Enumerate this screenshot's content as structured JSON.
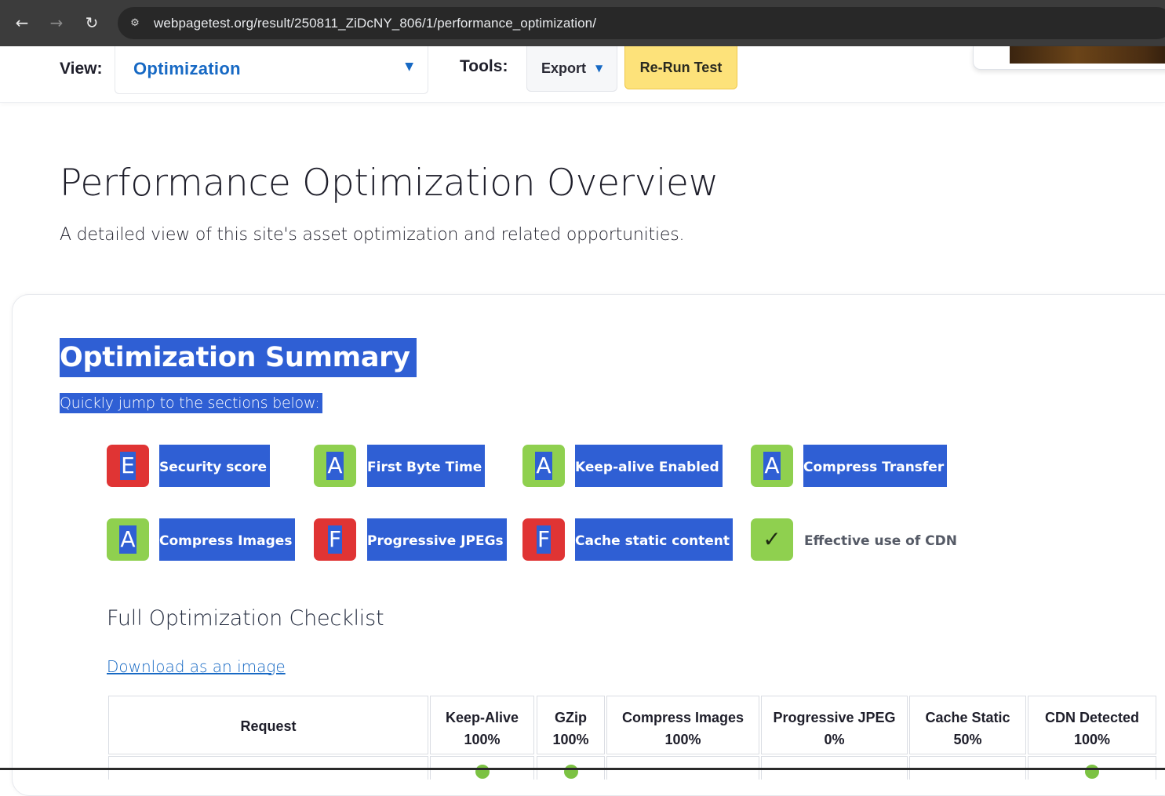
{
  "browser": {
    "url": "webpagetest.org/result/250811_ZiDcNY_806/1/performance_optimization/",
    "back_icon": "←",
    "forward_icon": "→",
    "reload_icon": "↻",
    "site_info_icon": "⚙"
  },
  "toolbar": {
    "view_label": "View:",
    "view_value": "Optimization",
    "dropdown_arrow": "▼",
    "tools_label": "Tools:",
    "export_label": "Export",
    "rerun_label": "Re-Run Test"
  },
  "header": {
    "title": "Performance Optimization Overview",
    "subtitle": "A detailed view of this site's asset optimization and related opportunities."
  },
  "summary": {
    "title": "Optimization Summary",
    "subtitle": "Quickly jump to the sections below:",
    "grades": [
      {
        "grade": "E",
        "label": "Security score",
        "status_color": "#e03434"
      },
      {
        "grade": "A",
        "label": "First Byte Time",
        "status_color": "#8fd04f"
      },
      {
        "grade": "A",
        "label": "Keep-alive Enabled",
        "status_color": "#8fd04f"
      },
      {
        "grade": "A",
        "label": "Compress Transfer",
        "status_color": "#8fd04f"
      },
      {
        "grade": "A",
        "label": "Compress Images",
        "status_color": "#8fd04f"
      },
      {
        "grade": "F",
        "label": "Progressive JPEGs",
        "status_color": "#e03434"
      },
      {
        "grade": "F",
        "label": "Cache static content",
        "status_color": "#e03434"
      },
      {
        "grade": "✓",
        "label": "Effective use of CDN",
        "status_color": "#8fd04f"
      }
    ]
  },
  "checklist": {
    "title": "Full Optimization Checklist",
    "download_label": "Download as an image",
    "columns": [
      {
        "name": "Request",
        "value": ""
      },
      {
        "name": "Keep-Alive",
        "value": "100%"
      },
      {
        "name": "GZip",
        "value": "100%"
      },
      {
        "name": "Compress Images",
        "value": "100%"
      },
      {
        "name": "Progressive JPEG",
        "value": "0%"
      },
      {
        "name": "Cache Static",
        "value": "50%"
      },
      {
        "name": "CDN Detected",
        "value": "100%"
      }
    ]
  },
  "colors": {
    "accent": "#1769c4",
    "selection": "#2f5fd4",
    "grade_pass": "#8fd04f",
    "grade_fail": "#e03434",
    "rerun": "#fde27a"
  }
}
